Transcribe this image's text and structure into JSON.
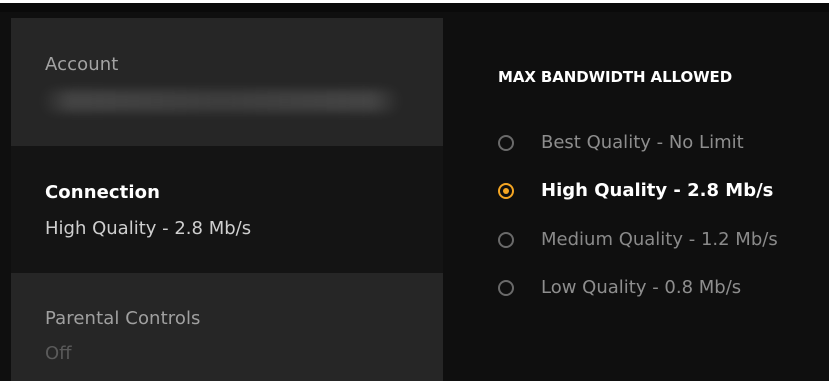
{
  "colors": {
    "accent": "#f5a623",
    "sidebar_bg": "#262626",
    "sidebar_selected_bg": "#141414",
    "panel_bg": "#0f0f0f"
  },
  "sidebar": {
    "items": [
      {
        "title": "Account",
        "subtitle": "",
        "selected": false
      },
      {
        "title": "Connection",
        "subtitle": "High Quality - 2.8 Mb/s",
        "selected": true
      },
      {
        "title": "Parental Controls",
        "subtitle": "Off",
        "selected": false
      }
    ]
  },
  "panel": {
    "heading": "MAX BANDWIDTH ALLOWED",
    "options": [
      {
        "label": "Best Quality - No Limit",
        "selected": false
      },
      {
        "label": "High Quality - 2.8 Mb/s",
        "selected": true
      },
      {
        "label": "Medium Quality - 1.2 Mb/s",
        "selected": false
      },
      {
        "label": "Low Quality - 0.8 Mb/s",
        "selected": false
      }
    ]
  }
}
